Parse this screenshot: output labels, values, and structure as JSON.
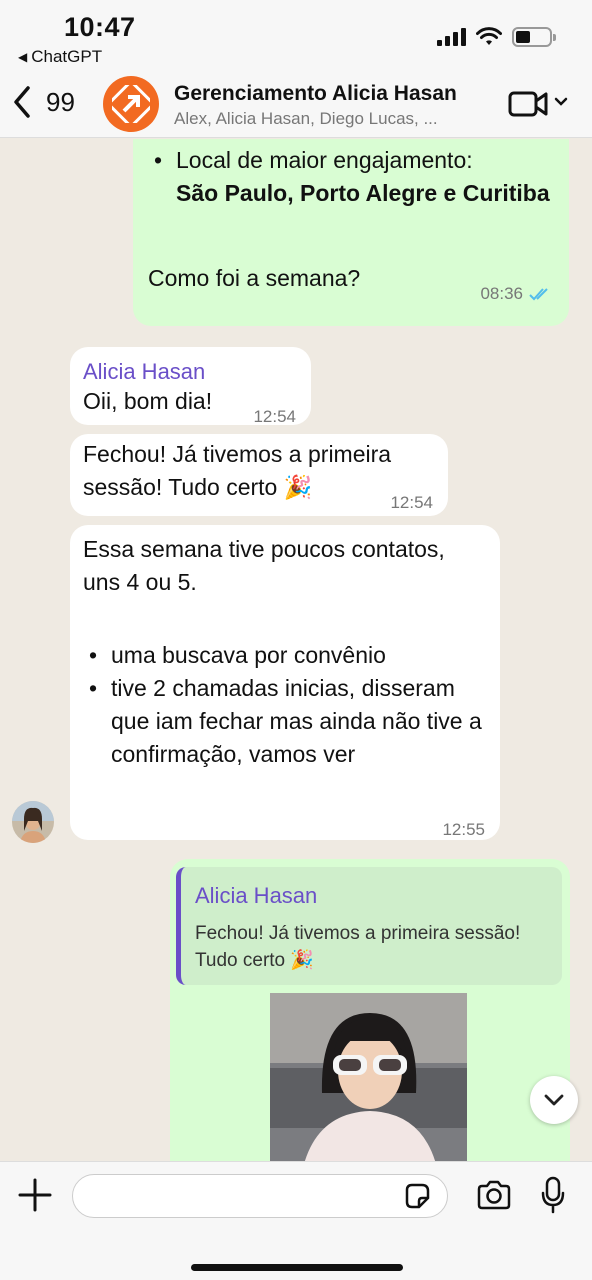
{
  "status_bar": {
    "time": "10:47",
    "back_app": "ChatGPT"
  },
  "header": {
    "back_count": "99",
    "title": "Gerenciamento Alicia Hasan",
    "subtitle": "Alex, Alicia Hasan, Diego Lucas, ...",
    "accent": "#f26a21"
  },
  "messages": {
    "m1": {
      "bullet_label": "Local de maior engajamento:",
      "bullet_bold": "São Paulo, Porto Alegre e Curitiba",
      "text": "Como foi a semana?",
      "time": "08:36"
    },
    "m2": {
      "sender": "Alicia Hasan",
      "text": "Oii, bom dia!",
      "time": "12:54"
    },
    "m3": {
      "text": "Fechou! Já tivemos a primeira sessão! Tudo certo 🎉",
      "time": "12:54"
    },
    "m4": {
      "text": "Essa semana tive poucos contatos, uns 4 ou 5.",
      "bullets": [
        "uma buscava por convênio",
        "tive 2 chamadas inicias, disseram que iam fechar mas ainda não tive a confirmação, vamos ver"
      ],
      "time": "12:55"
    },
    "m5": {
      "quote_sender": "Alicia Hasan",
      "quote_text": "Fechou! Já tivemos a primeira sessão! Tudo certo 🎉"
    }
  },
  "input": {
    "placeholder": ""
  },
  "colors": {
    "outgoing": "#d9fdd3",
    "incoming": "#ffffff",
    "sender_name": "#6a4fc8",
    "read_ticks": "#53bdeb"
  }
}
